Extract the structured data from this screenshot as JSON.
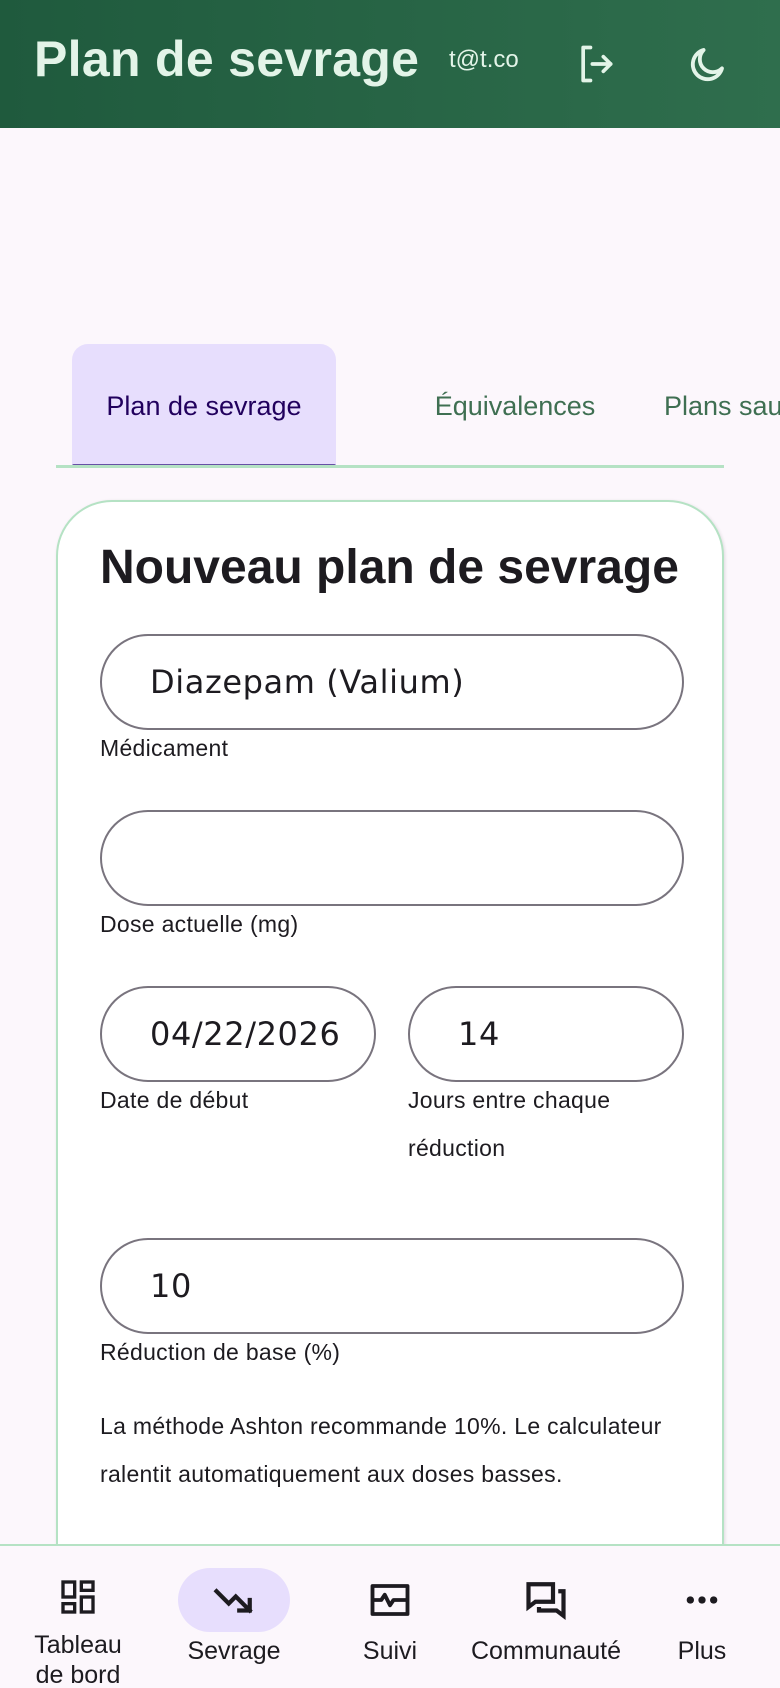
{
  "header": {
    "title": "Plan de sevrage",
    "user_email": "t@t.co",
    "logout_icon": "logout-icon",
    "theme_icon": "moon-icon"
  },
  "tabs": [
    {
      "label": "Plan de sevrage",
      "active": true
    },
    {
      "label": "Équivalences",
      "active": false
    },
    {
      "label": "Plans sau",
      "active": false
    }
  ],
  "form": {
    "title": "Nouveau plan de sevrage",
    "medication": {
      "value": "Diazepam (Valium)",
      "label": "Médicament"
    },
    "current_dose": {
      "value": "",
      "label": "Dose actuelle (mg)"
    },
    "start_date": {
      "value": "04/22/2026",
      "label": "Date de début"
    },
    "days_between": {
      "value": "14",
      "label": "Jours entre chaque réduction"
    },
    "base_reduction": {
      "value": "10",
      "label": "Réduction de base (%)"
    },
    "help_text": "La méthode Ashton recommande 10%. Le calculateur ralentit automatiquement aux doses basses."
  },
  "bottom_nav": [
    {
      "label": "Tableau de bord",
      "icon": "dashboard-icon",
      "active": false
    },
    {
      "label": "Sevrage",
      "icon": "trending-down-icon",
      "active": true
    },
    {
      "label": "Suivi",
      "icon": "monitor-heart-icon",
      "active": false
    },
    {
      "label": "Communauté",
      "icon": "forum-icon",
      "active": false
    },
    {
      "label": "Plus",
      "icon": "more-horizontal-icon",
      "active": false
    }
  ],
  "colors": {
    "header_bg": "#1f5a3d",
    "accent": "#6750a4",
    "active_bg": "#e7defd",
    "border_green": "#b5e2c4",
    "tab_inactive": "#3f6f52"
  }
}
